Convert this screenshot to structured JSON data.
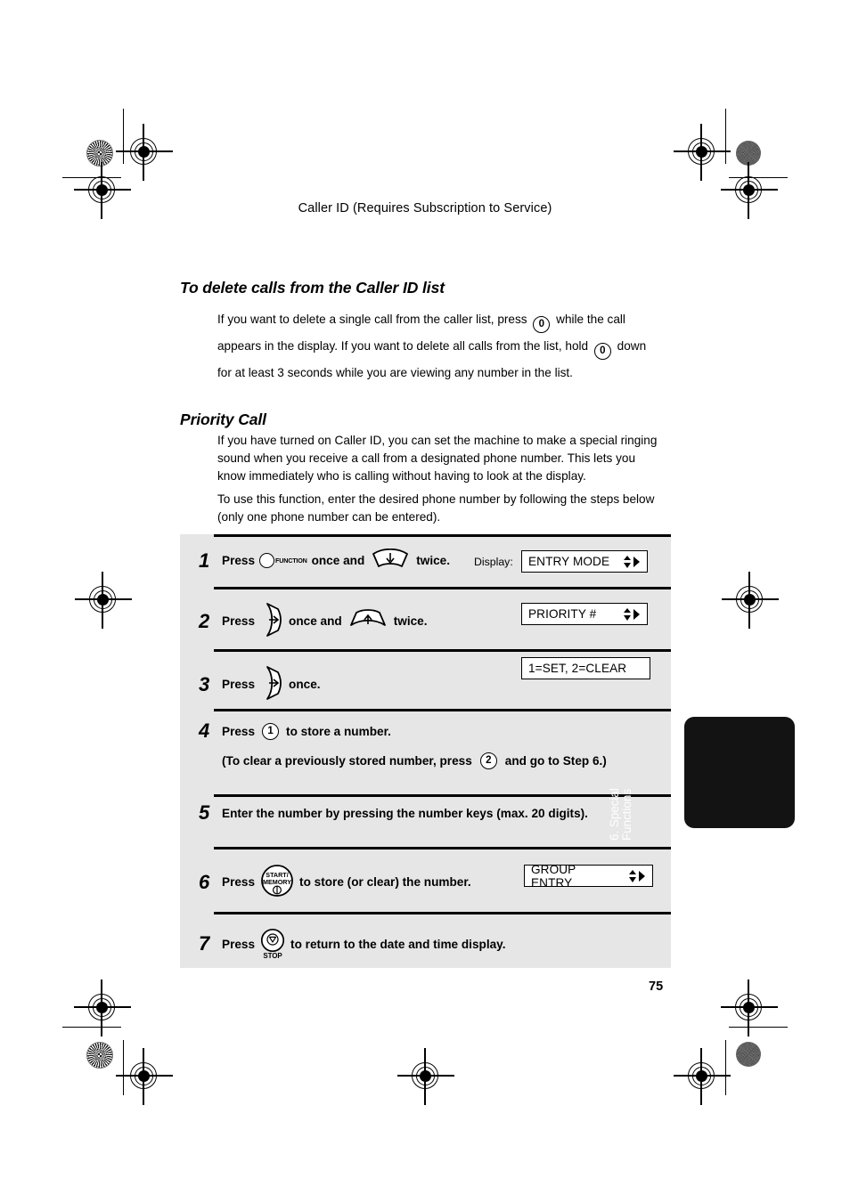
{
  "page": {
    "running_head": "Caller ID (Requires Subscription to Service)",
    "page_number": "75"
  },
  "sections": [
    {
      "heading": "To delete calls from the Caller ID list",
      "paragraph_parts": {
        "a": "If you want to delete a single call from the caller list, press",
        "key1": "0",
        "b": "while the call appears in the display. If you want to delete all calls from the list, hold",
        "key2": "0",
        "c": "down for at least 3 seconds while you are viewing any number in the list."
      }
    },
    {
      "heading": "Priority Call",
      "paragraph_1": "If you have turned on Caller ID, you can set the machine to make a special ringing sound when you receive a call from a designated phone number. This lets you know immediately who is calling without having to look at the display.",
      "paragraph_2": "To use this function, enter the desired phone number by following the steps below (only one phone number can be entered)."
    }
  ],
  "procedure": {
    "display_label": "Display:",
    "steps": [
      {
        "number": "1",
        "press_word": "Press",
        "key_a_icon": "function-key-icon",
        "key_a_label": "FUNCTION",
        "mid_text": "once and",
        "key_b_icon": "down-arrow-fan-key-icon",
        "tail_text": "twice.",
        "display": "ENTRY MODE",
        "display_has_arrows": true
      },
      {
        "number": "2",
        "press_word": "Press",
        "key_a_icon": "right-arrow-wedge-key-icon",
        "mid_text": "once and",
        "key_b_icon": "up-arrow-fan-key-icon",
        "tail_text": "twice.",
        "display": "PRIORITY #",
        "display_has_arrows": true
      },
      {
        "number": "3",
        "press_word": "Press",
        "key_a_icon": "right-arrow-wedge-key-icon",
        "tail_text": "once.",
        "display": "1=SET, 2=CLEAR",
        "display_has_arrows": false
      },
      {
        "number": "4",
        "press_word": "Press",
        "key_a_icon": "numeric-key-1-icon",
        "key_a_label": "1",
        "tail_text": "to store a number.",
        "sub_text_a": "(To clear a previously stored number, press",
        "sub_key": "2",
        "sub_text_b": "and go to Step 6.)"
      },
      {
        "number": "5",
        "full_text": "Enter the number by pressing the number keys (max. 20 digits)."
      },
      {
        "number": "6",
        "press_word": "Press",
        "key_a_icon": "start-memory-key-icon",
        "key_a_label_line1": "START/",
        "key_a_label_line2": "MEMORY",
        "tail_text": "to store (or clear) the number.",
        "display": "GROUP ENTRY",
        "display_has_arrows": true
      },
      {
        "number": "7",
        "press_word": "Press",
        "key_a_icon": "stop-key-icon",
        "key_a_label": "STOP",
        "tail_text": "to return to the date and time display."
      }
    ]
  },
  "side_tab": {
    "line1": "6. Special",
    "line2": "Functions"
  },
  "colors": {
    "panel_background": "#e6e6e6",
    "side_tab_background": "#131313",
    "rule": "#000000",
    "page_background": "#ffffff"
  }
}
